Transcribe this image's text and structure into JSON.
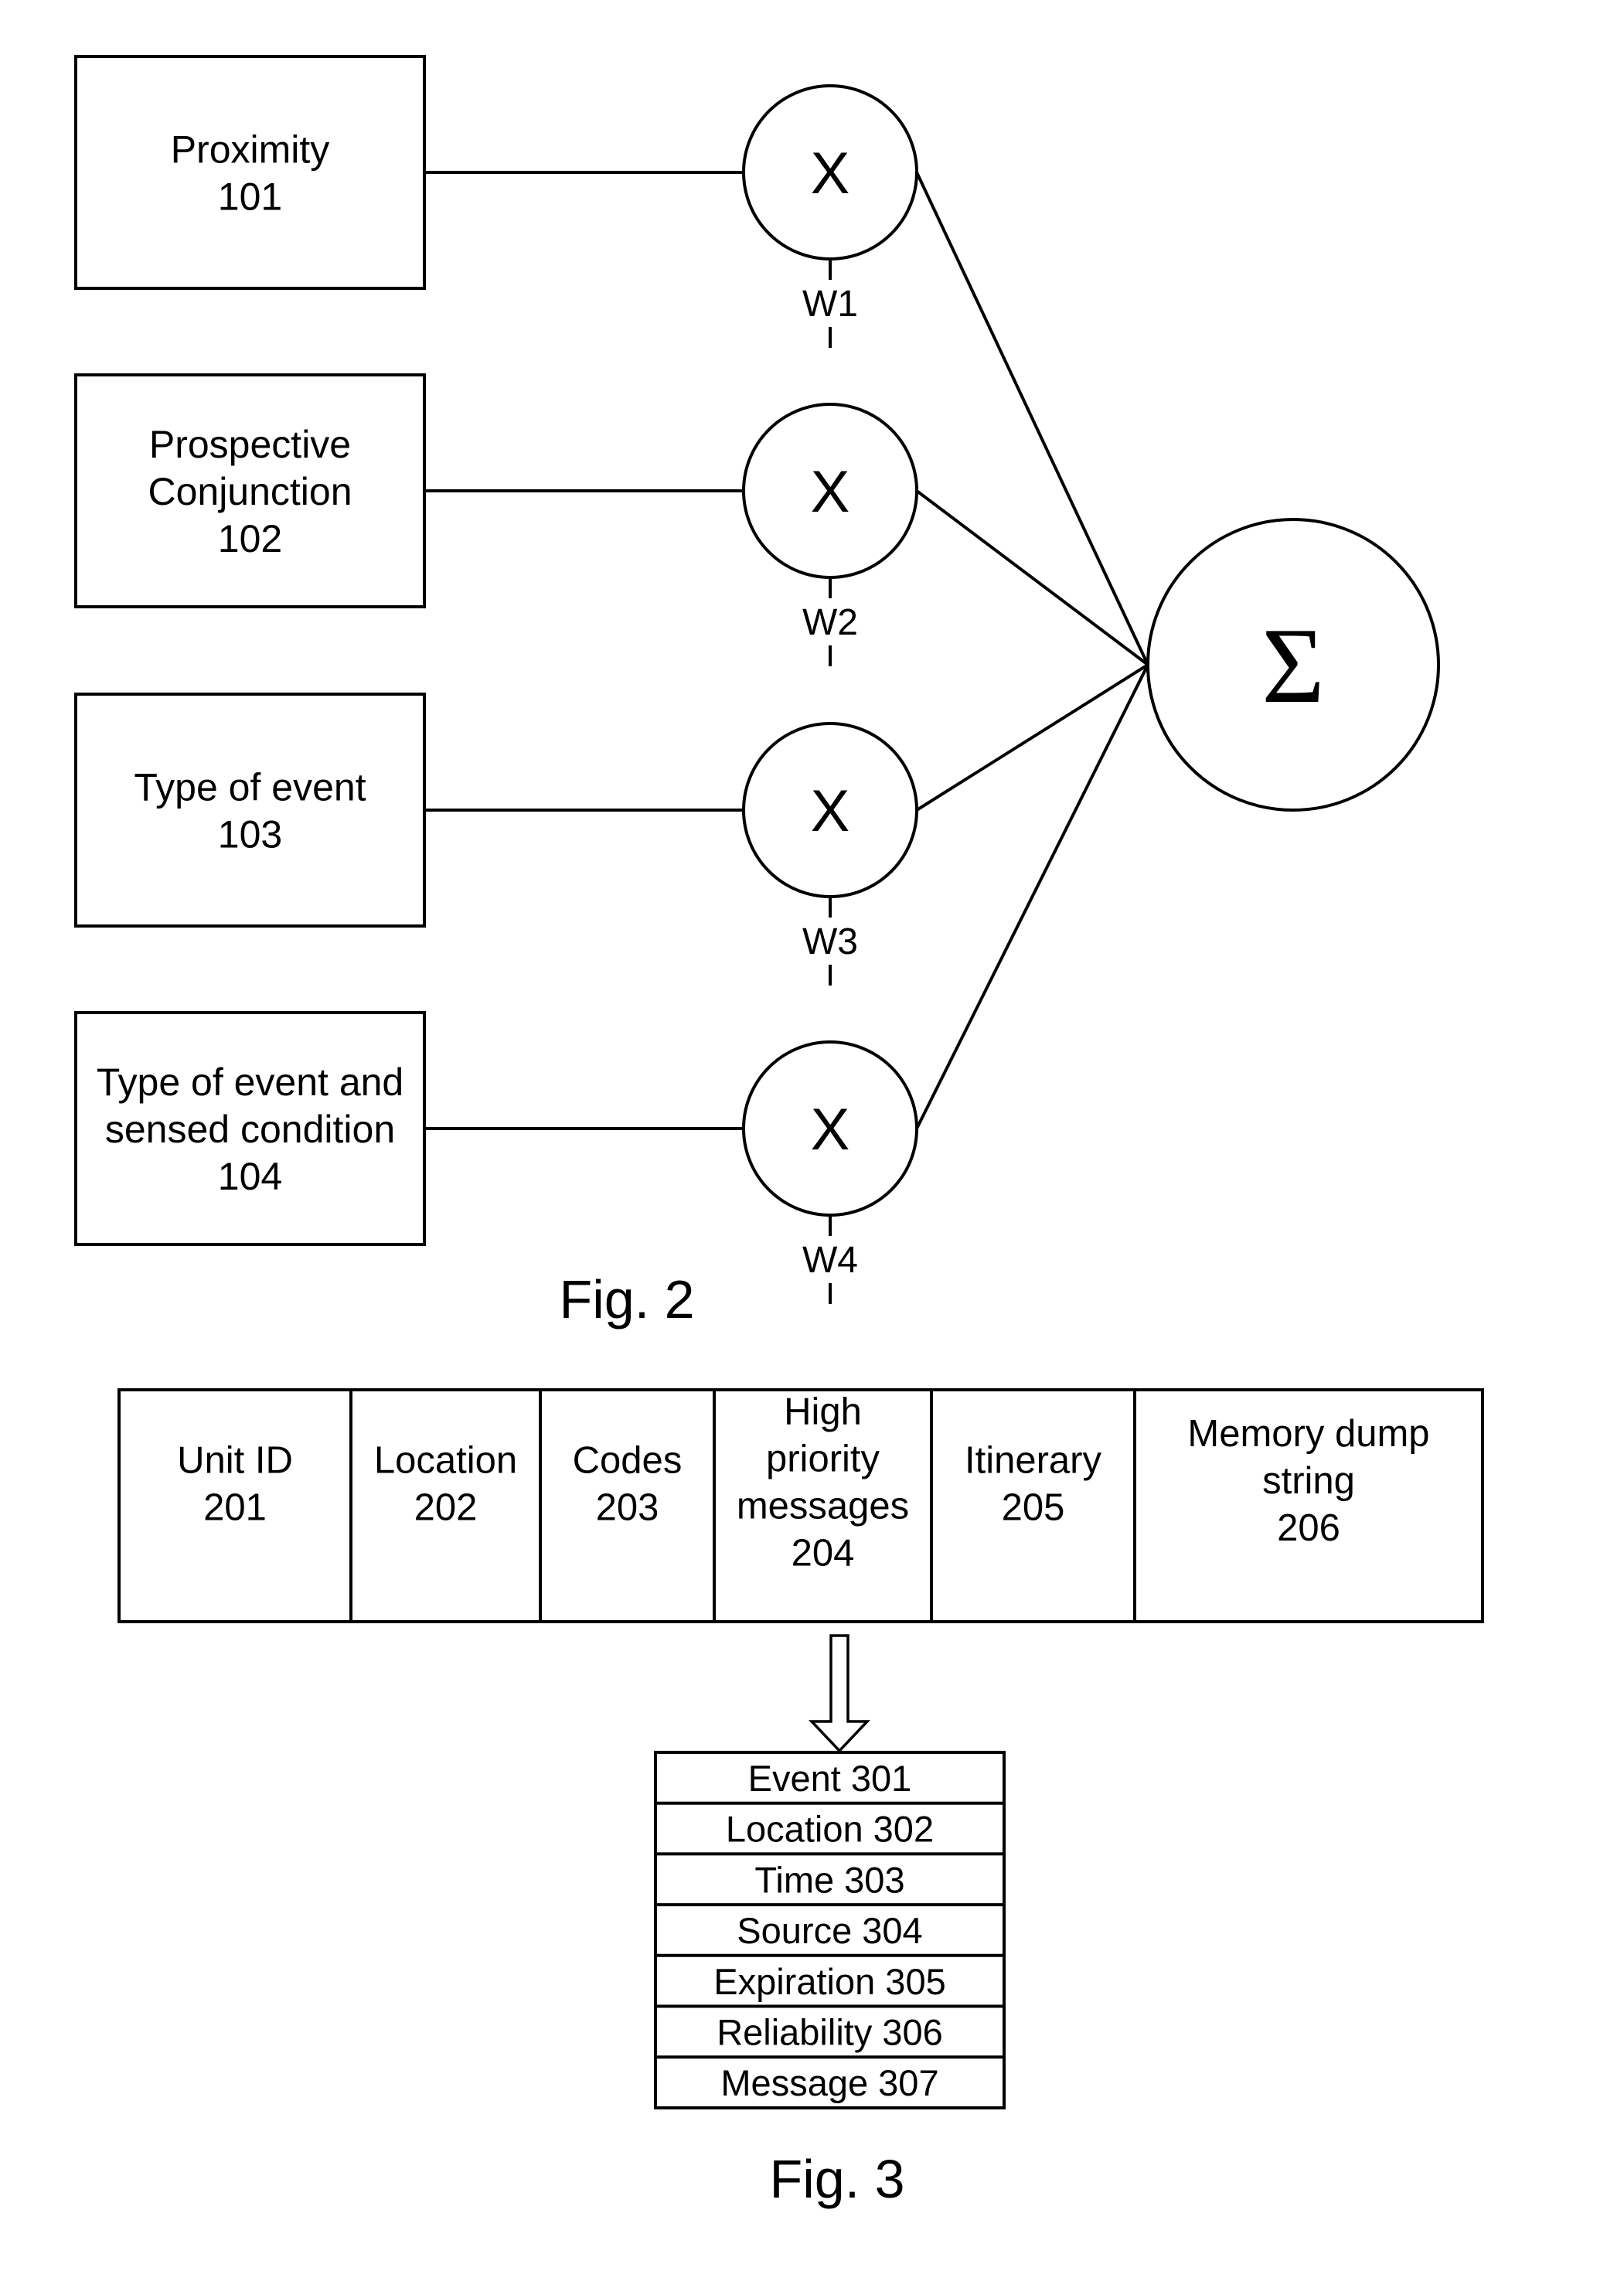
{
  "figure2": {
    "caption": "Fig. 2",
    "inputs": [
      {
        "lines": [
          "Proximity",
          "101"
        ]
      },
      {
        "lines": [
          "Prospective",
          "Conjunction",
          "102"
        ]
      },
      {
        "lines": [
          "Type of event",
          "103"
        ]
      },
      {
        "lines": [
          "Type of event and",
          "sensed condition",
          "104"
        ]
      }
    ],
    "multipliers": [
      {
        "symbol": "X",
        "weight": "W1"
      },
      {
        "symbol": "X",
        "weight": "W2"
      },
      {
        "symbol": "X",
        "weight": "W3"
      },
      {
        "symbol": "X",
        "weight": "W4"
      }
    ],
    "summation": {
      "symbol": "Σ"
    }
  },
  "figure3": {
    "caption": "Fig. 3",
    "record_fields": [
      {
        "lines": [
          "Unit ID",
          "201"
        ]
      },
      {
        "lines": [
          "Location",
          "202"
        ]
      },
      {
        "lines": [
          "Codes",
          "203"
        ]
      },
      {
        "lines": [
          "High",
          "priority",
          "messages",
          "204"
        ]
      },
      {
        "lines": [
          "Itinerary",
          "205"
        ]
      },
      {
        "lines": [
          "Memory dump",
          "string",
          "206"
        ]
      }
    ],
    "expanded_field_index": 3,
    "message_fields": [
      "Event 301",
      "Location 302",
      "Time 303",
      "Source 304",
      "Expiration 305",
      "Reliability 306",
      "Message 307"
    ]
  }
}
